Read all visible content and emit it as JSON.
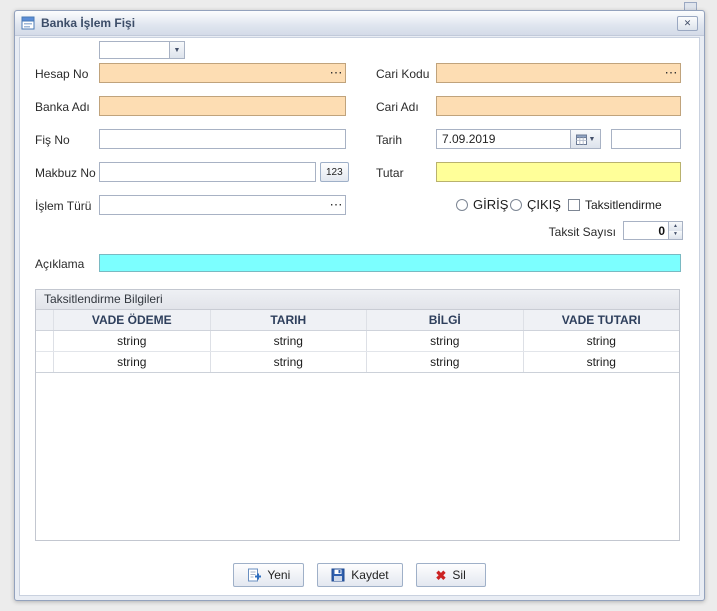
{
  "window": {
    "title": "Banka İşlem Fişi",
    "close_icon": "✕"
  },
  "icons": {
    "ellipsis": "⋯",
    "dropdown_arrow": "▼",
    "spin_up": "▲",
    "spin_down": "▼",
    "delete_glyph": "✖"
  },
  "combo": {
    "value": ""
  },
  "fields": {
    "hesap_no": {
      "label": "Hesap No",
      "value": ""
    },
    "banka_adi": {
      "label": "Banka Adı",
      "value": ""
    },
    "fis_no": {
      "label": "Fiş No",
      "value": ""
    },
    "makbuz_no": {
      "label": "Makbuz No",
      "value": "",
      "button_label": "123"
    },
    "islem_turu": {
      "label": "İşlem Türü",
      "value": ""
    },
    "cari_kodu": {
      "label": "Cari Kodu",
      "value": ""
    },
    "cari_adi": {
      "label": "Cari Adı",
      "value": ""
    },
    "tarih": {
      "label": "Tarih",
      "value": "7.09.2019"
    },
    "tarih_extra": {
      "value": ""
    },
    "tutar": {
      "label": "Tutar",
      "value": ""
    },
    "aciklama": {
      "label": "Açıklama",
      "value": ""
    }
  },
  "options": {
    "giris_label": "GİRİŞ",
    "cikis_label": "ÇIKIŞ",
    "taksitlendirme_label": "Taksitlendirme",
    "taksit_sayisi_label": "Taksit Sayısı",
    "taksit_sayisi_value": "0"
  },
  "grid": {
    "title": "Taksitlendirme Bilgileri",
    "columns": [
      "VADE ÖDEME",
      "TARIH",
      "BİLGİ",
      "VADE TUTARI"
    ],
    "rows": [
      [
        "string",
        "string",
        "string",
        "string"
      ],
      [
        "string",
        "string",
        "string",
        "string"
      ]
    ]
  },
  "buttons": {
    "yeni": "Yeni",
    "kaydet": "Kaydet",
    "sil": "Sil"
  },
  "colors": {
    "required_field": "#FDDDB3",
    "amount_field": "#FFFF99",
    "description_field": "#7CFFFF"
  }
}
